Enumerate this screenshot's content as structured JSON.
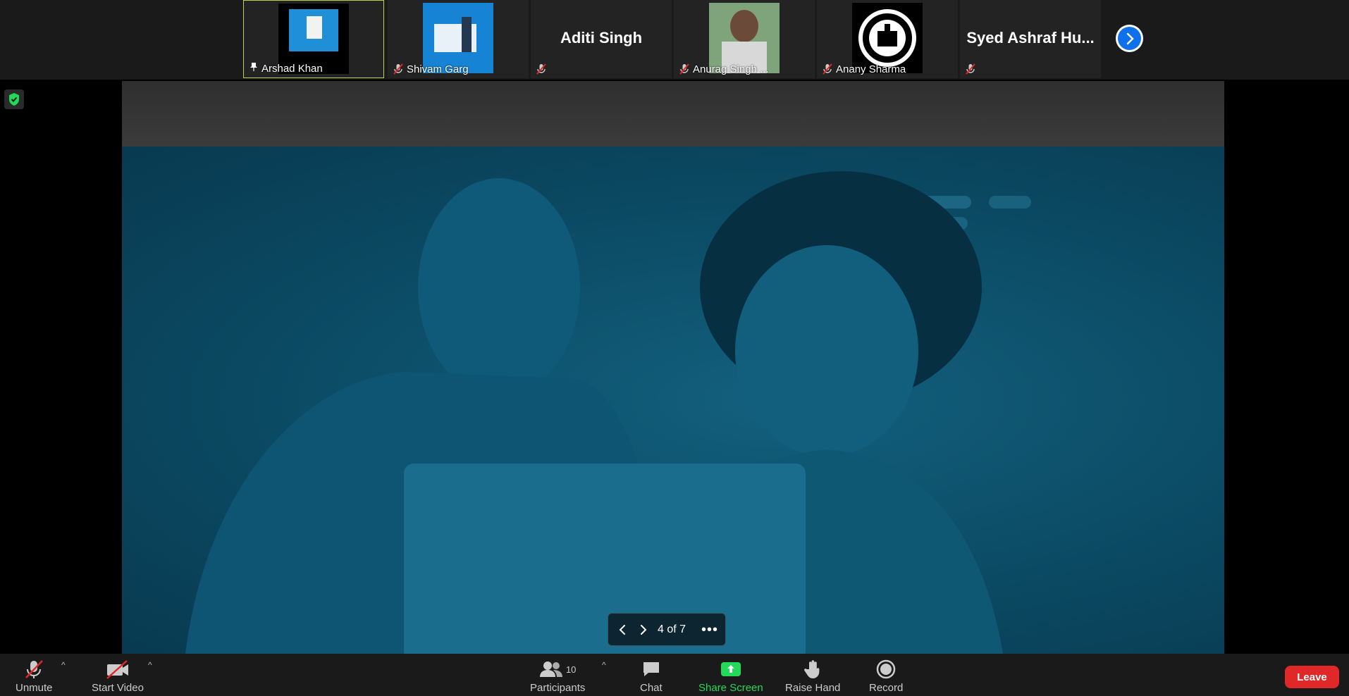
{
  "participants": [
    {
      "name": "Arshad Khan",
      "pinned": true,
      "muted": false,
      "active": true,
      "has_video": true
    },
    {
      "name": "Shivam Garg",
      "pinned": false,
      "muted": true,
      "active": false,
      "has_video": true
    },
    {
      "name": "Aditi Singh",
      "pinned": false,
      "muted": true,
      "active": false,
      "has_video": false
    },
    {
      "name": "Anurag Singh ...",
      "pinned": false,
      "muted": true,
      "active": false,
      "has_video": true
    },
    {
      "name": "Anany Sharma",
      "pinned": false,
      "muted": true,
      "active": false,
      "has_video": true
    },
    {
      "name": "Syed Ashraf Hu...",
      "pinned": false,
      "muted": true,
      "active": false,
      "has_video": false
    }
  ],
  "slide": {
    "page_indicator": "4 of 7"
  },
  "toolbar": {
    "unmute": "Unmute",
    "start_video": "Start Video",
    "participants": "Participants",
    "participants_count": "10",
    "chat": "Chat",
    "share_screen": "Share Screen",
    "raise_hand": "Raise Hand",
    "record": "Record",
    "leave": "Leave"
  },
  "colors": {
    "accent_blue": "#0e71eb",
    "share_green": "#23d959",
    "leave_red": "#e02828",
    "active_border": "#b9d34a",
    "mute_red": "#e02828"
  }
}
